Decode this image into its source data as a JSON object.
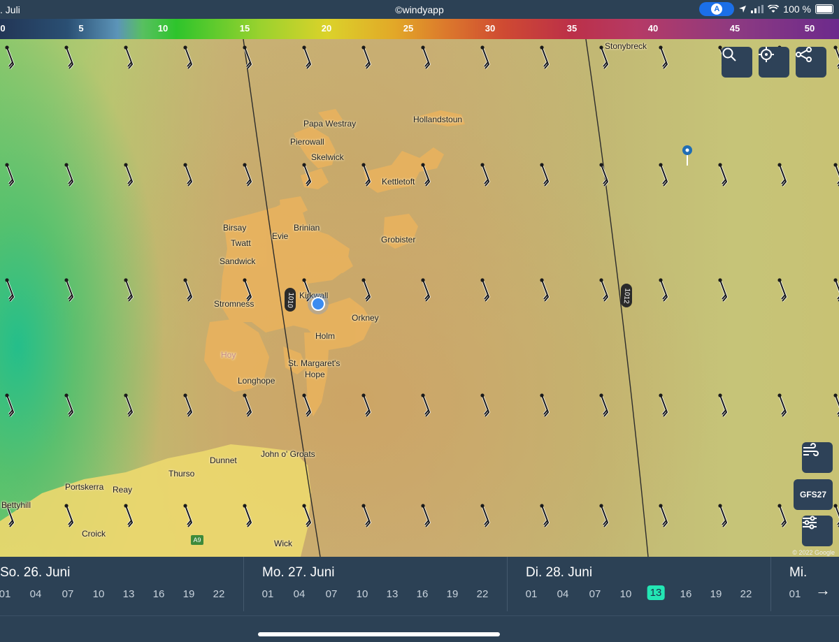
{
  "status_bar": {
    "date": ". Juli",
    "credit": "©windyapp",
    "battery": "100 %",
    "location_badge": "A",
    "icons": [
      "navigation-arrow-icon",
      "signal-icon",
      "wifi-icon",
      "battery-icon"
    ]
  },
  "legend": {
    "ticks": [
      "0",
      "5",
      "10",
      "15",
      "20",
      "25",
      "30",
      "35",
      "40",
      "45",
      "50"
    ]
  },
  "map": {
    "places": [
      "Stonybreck",
      "Papa Westray",
      "Hollandstoun",
      "Pierowall",
      "Skelwick",
      "Kettletoft",
      "Birsay",
      "Brinian",
      "Evie",
      "Twatt",
      "Grobister",
      "Sandwick",
      "Kirkwall",
      "Stromness",
      "Orkney",
      "Holm",
      "Hoy",
      "St. Margaret's",
      "Hope",
      "Longhope",
      "Dunnet",
      "John o' Groats",
      "Thurso",
      "Portskerra",
      "Reay",
      "Bettyhill",
      "Croick",
      "Wick"
    ],
    "isobars": [
      "1010",
      "1012"
    ],
    "road_sign": "A9",
    "copyright": "© 2022 Google",
    "model_button": "GFS27",
    "buttons": {
      "search": "search-icon",
      "locate": "crosshair-icon",
      "share": "share-icon",
      "wind": "wind-icon",
      "settings": "sliders-icon"
    }
  },
  "timeline": {
    "days": [
      {
        "title": "So. 26. Juni",
        "hours": [
          "01",
          "04",
          "07",
          "10",
          "13",
          "16",
          "19",
          "22"
        ]
      },
      {
        "title": "Mo. 27. Juni",
        "hours": [
          "01",
          "04",
          "07",
          "10",
          "13",
          "16",
          "19",
          "22"
        ]
      },
      {
        "title": "Di. 28. Juni",
        "hours": [
          "01",
          "04",
          "07",
          "10",
          "13",
          "16",
          "19",
          "22"
        ]
      },
      {
        "title": "Mi.",
        "hours": [
          "01"
        ]
      }
    ],
    "selected": {
      "day": "Di. 28. Juni",
      "hour": "13"
    },
    "next_arrow": "→"
  }
}
